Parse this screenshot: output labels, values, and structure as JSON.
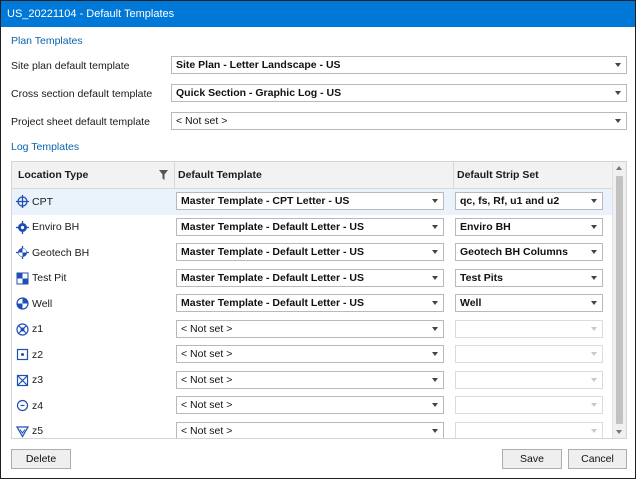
{
  "window": {
    "title": "US_20221104 - Default Templates"
  },
  "plan": {
    "section_title": "Plan Templates",
    "rows": [
      {
        "label": "Site plan default template",
        "value": "Site Plan - Letter Landscape - US"
      },
      {
        "label": "Cross section default template",
        "value": "Quick Section - Graphic Log - US"
      },
      {
        "label": "Project sheet default template",
        "value": "< Not set >"
      }
    ]
  },
  "log": {
    "section_title": "Log Templates",
    "headers": {
      "location_type": "Location Type",
      "default_template": "Default Template",
      "default_strip_set": "Default Strip Set"
    },
    "rows": [
      {
        "location": "CPT",
        "icon": "cpt-symbol-icon",
        "template": "Master Template - CPT Letter - US",
        "strip": "qc, fs, Rf, u1 and u2",
        "selected": true
      },
      {
        "location": "Enviro BH",
        "icon": "enviro-bh-symbol-icon",
        "template": "Master Template - Default Letter - US",
        "strip": "Enviro BH"
      },
      {
        "location": "Geotech BH",
        "icon": "geotech-bh-symbol-icon",
        "template": "Master Template - Default Letter - US",
        "strip": "Geotech BH Columns"
      },
      {
        "location": "Test Pit",
        "icon": "test-pit-symbol-icon",
        "template": "Master Template - Default Letter - US",
        "strip": "Test Pits"
      },
      {
        "location": "Well",
        "icon": "well-symbol-icon",
        "template": "Master Template - Default Letter - US",
        "strip": "Well"
      },
      {
        "location": "z1",
        "icon": "z1-symbol-icon",
        "template": "< Not set >",
        "strip": ""
      },
      {
        "location": "z2",
        "icon": "z2-symbol-icon",
        "template": "< Not set >",
        "strip": ""
      },
      {
        "location": "z3",
        "icon": "z3-symbol-icon",
        "template": "< Not set >",
        "strip": ""
      },
      {
        "location": "z4",
        "icon": "z4-symbol-icon",
        "template": "< Not set >",
        "strip": ""
      },
      {
        "location": "z5",
        "icon": "z5-symbol-icon",
        "template": "< Not set >",
        "strip": ""
      }
    ]
  },
  "buttons": {
    "delete": "Delete",
    "save": "Save",
    "cancel": "Cancel"
  },
  "colors": {
    "title_bar": "#0078d7",
    "section_title": "#0a64ad",
    "symbol": "#1f4fb5",
    "selected_row": "#eaf2fb"
  }
}
